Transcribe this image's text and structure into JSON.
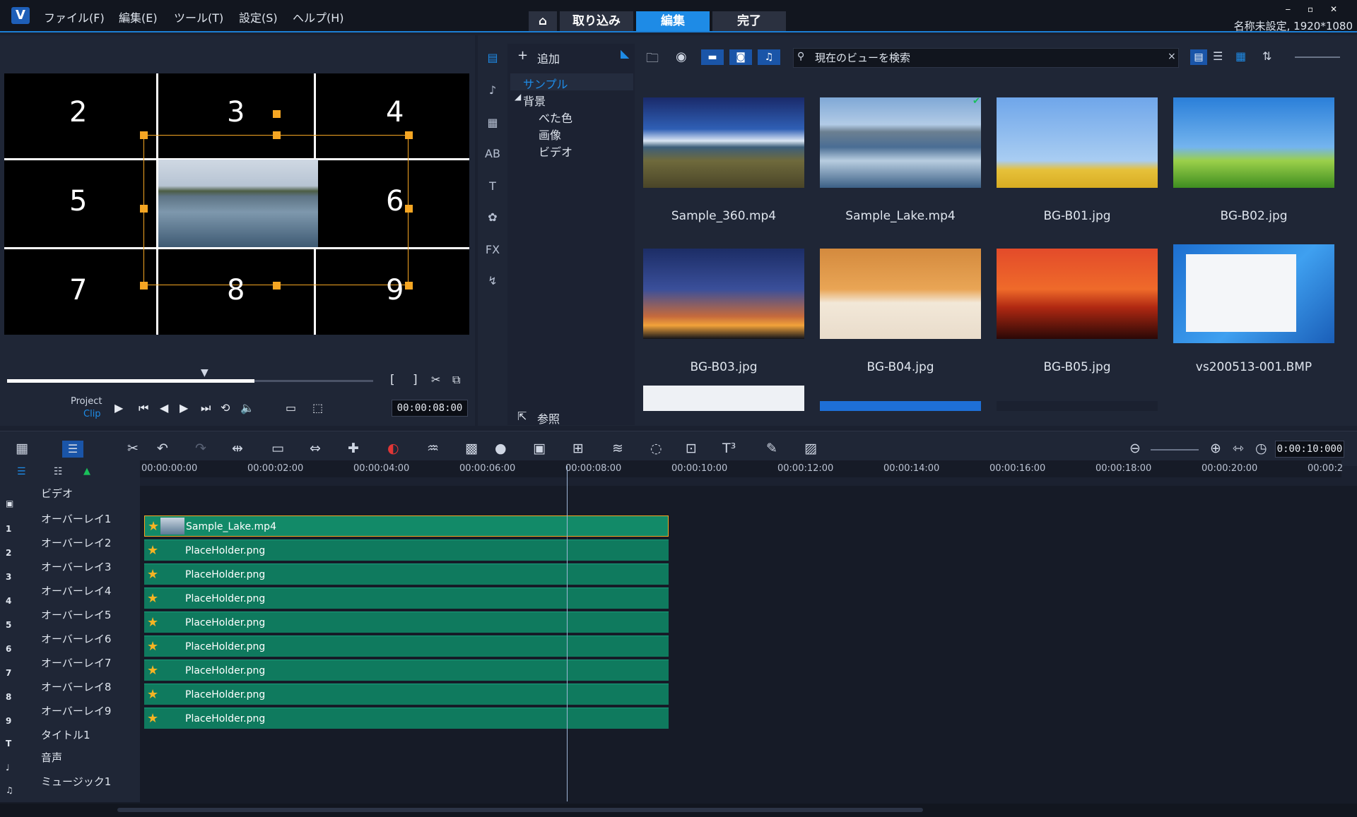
{
  "menu": [
    "ファイル(F)",
    "編集(E)",
    "ツール(T)",
    "設定(S)",
    "ヘルプ(H)"
  ],
  "nav": {
    "home": "⌂",
    "capture": "取り込み",
    "edit": "編集",
    "finish": "完了"
  },
  "project_info": "名称未設定, 1920*1080",
  "preview": {
    "grid_numbers": [
      "2",
      "3",
      "4",
      "5",
      "6",
      "7",
      "8",
      "9"
    ],
    "mode_project": "Project",
    "mode_clip": "Clip",
    "timecode": "00:00:08:00"
  },
  "library": {
    "add_label": "追加",
    "tree": {
      "sample": "サンプル",
      "background": "背景",
      "solid": "べた色",
      "image": "画像",
      "video": "ビデオ"
    },
    "browse_label": "参照",
    "search_placeholder": "現在のビューを検索",
    "items": [
      "Sample_360.mp4",
      "Sample_Lake.mp4",
      "BG-B01.jpg",
      "BG-B02.jpg",
      "BG-B03.jpg",
      "BG-B04.jpg",
      "BG-B05.jpg",
      "vs200513-001.BMP"
    ]
  },
  "timeline": {
    "timecode": "0:00:10:000",
    "ruler": [
      "00:00:00:00",
      "00:00:02:00",
      "00:00:04:00",
      "00:00:06:00",
      "00:00:08:00",
      "00:00:10:00",
      "00:00:12:00",
      "00:00:14:00",
      "00:00:16:00",
      "00:00:18:00",
      "00:00:20:00",
      "00:00:2"
    ],
    "tracks": [
      "ビデオ",
      "オーバーレイ1",
      "オーバーレイ2",
      "オーバーレイ3",
      "オーバーレイ4",
      "オーバーレイ5",
      "オーバーレイ6",
      "オーバーレイ7",
      "オーバーレイ8",
      "オーバーレイ9",
      "タイトル1",
      "音声",
      "ミュージック1"
    ],
    "clips": [
      "Sample_Lake.mp4",
      "PlaceHolder.png",
      "PlaceHolder.png",
      "PlaceHolder.png",
      "PlaceHolder.png",
      "PlaceHolder.png",
      "PlaceHolder.png",
      "PlaceHolder.png",
      "PlaceHolder.png"
    ]
  }
}
